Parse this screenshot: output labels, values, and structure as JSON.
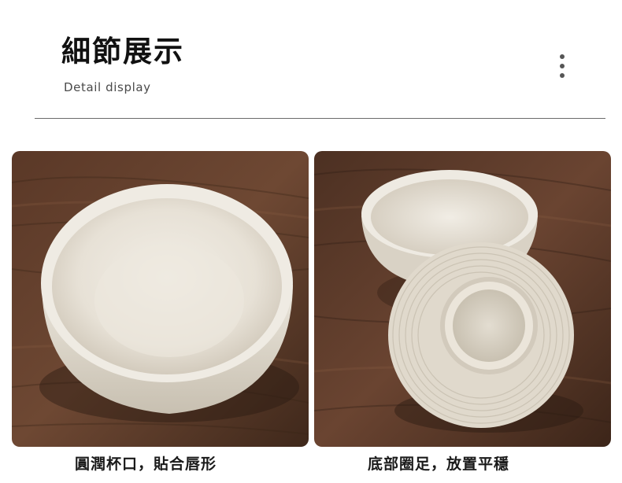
{
  "header": {
    "title": "細節展示",
    "subtitle": "Detail display",
    "menu_icon": "more-vertical-icon"
  },
  "photos": [
    {
      "subject": "cup-top-view-image",
      "caption": "圓潤杯口，貼合唇形"
    },
    {
      "subject": "cup-bottom-view-image",
      "caption": "底部圈足，放置平穩"
    }
  ],
  "colors": {
    "wood_dark": "#4a2e1f",
    "wood_light": "#7a5139",
    "ceramic": "#e9e4da",
    "ceramic_shadow": "#c9c1b3",
    "divider": "#6b6b6b"
  }
}
